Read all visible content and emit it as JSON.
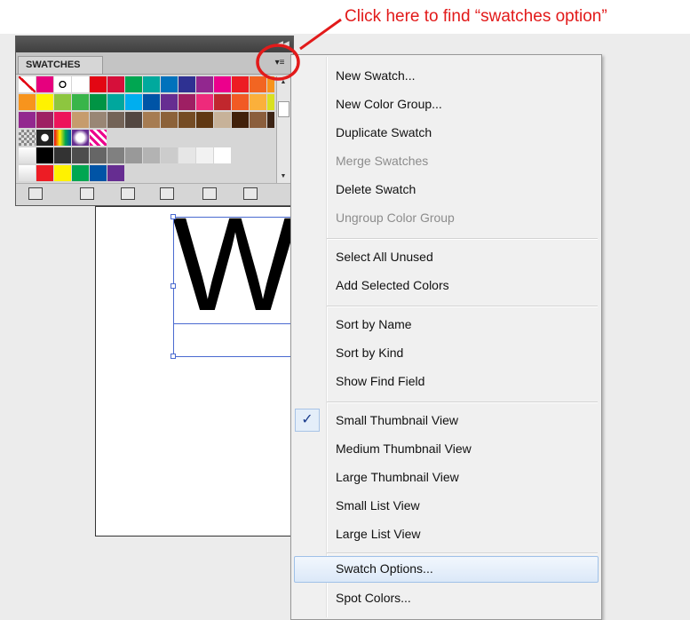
{
  "annotation": {
    "text": "Click here to find “swatches option”",
    "color": "#e21a1a"
  },
  "panel": {
    "tab_label": "SWATCHES",
    "menu_button_icon": "panel-menu-icon",
    "collapse_icon": "double-chevron-icon",
    "swatch_rows": [
      [
        "none",
        "#e6007e",
        "registration",
        "#ffffff",
        "#e30613",
        "#d60f3a",
        "#00a651",
        "#00a99d",
        "#0072bc",
        "#2e3192",
        "#92278f",
        "#ec008c",
        "#ed1c24",
        "#f26522",
        "#f7941d"
      ],
      [
        "#f7941d",
        "#fff200",
        "#8dc63f",
        "#39b54a",
        "#009444",
        "#00a79d",
        "#00aeef",
        "#0054a6",
        "#662d91",
        "#9e1f63",
        "#ee2a7b",
        "#c1272d",
        "#f15a24",
        "#fbb03b",
        "#d9e021"
      ],
      [
        "#93278f",
        "#9e1f63",
        "#ed145b",
        "#c69c6d",
        "#998675",
        "#736357",
        "#534741",
        "#a67c52",
        "#8c6239",
        "#754c24",
        "#603813",
        "#c7b299",
        "#42210b",
        "#8b5e3c",
        "#3c2415"
      ],
      [
        "pattern-grey",
        "pattern-dots",
        "gradient-rainbow",
        "gradient-radial",
        "pattern-pink"
      ],
      [
        "folder",
        "#000000",
        "#333333",
        "#4d4d4d",
        "#666666",
        "#808080",
        "#999999",
        "#b3b3b3",
        "#cccccc",
        "#e6e6e6",
        "#f2f2f2",
        "#ffffff"
      ],
      [
        "folder",
        "#ed1c24",
        "#fff200",
        "#00a651",
        "#0054a6",
        "#662d91"
      ]
    ],
    "toolbar_icons": [
      "swatch-libraries-icon",
      "show-swatch-kinds-icon",
      "swatch-options-icon",
      "new-color-group-icon",
      "new-swatch-icon",
      "delete-swatch-icon"
    ]
  },
  "menu": {
    "check_mark": "✓",
    "items": [
      {
        "label": "New Swatch...",
        "enabled": true
      },
      {
        "label": "New Color Group...",
        "enabled": true
      },
      {
        "label": "Duplicate Swatch",
        "enabled": true
      },
      {
        "label": "Merge Swatches",
        "enabled": false
      },
      {
        "label": "Delete Swatch",
        "enabled": true
      },
      {
        "label": "Ungroup Color Group",
        "enabled": false
      },
      {
        "label": "Select All Unused",
        "enabled": true
      },
      {
        "label": "Add Selected Colors",
        "enabled": true
      },
      {
        "label": "Sort by Name",
        "enabled": true
      },
      {
        "label": "Sort by Kind",
        "enabled": true
      },
      {
        "label": "Show Find Field",
        "enabled": true
      },
      {
        "label": "Small Thumbnail View",
        "enabled": true,
        "checked": true
      },
      {
        "label": "Medium Thumbnail View",
        "enabled": true
      },
      {
        "label": "Large Thumbnail View",
        "enabled": true
      },
      {
        "label": "Small List View",
        "enabled": true
      },
      {
        "label": "Large List View",
        "enabled": true
      },
      {
        "label": "Swatch Options...",
        "enabled": true,
        "highlighted": true
      },
      {
        "label": "Spot Colors...",
        "enabled": true
      }
    ]
  },
  "artboard": {
    "text": "W"
  }
}
